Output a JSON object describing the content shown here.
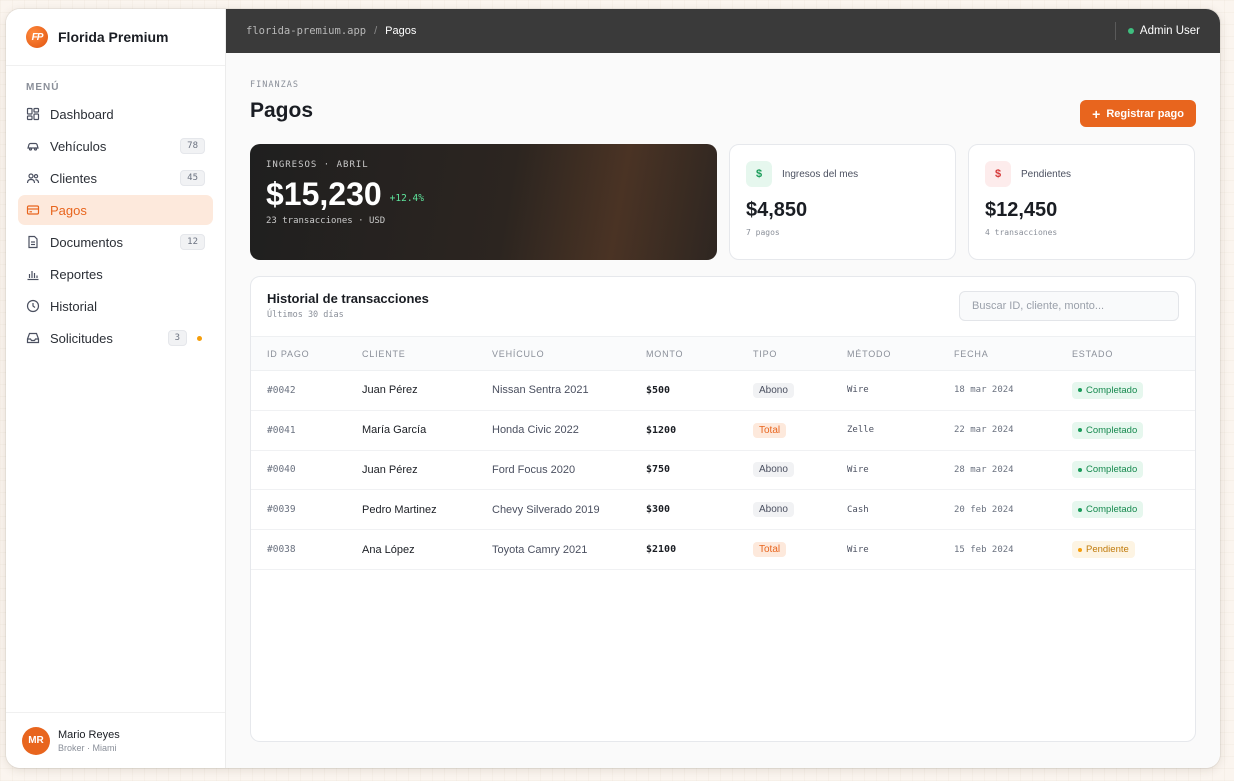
{
  "brand": {
    "name": "Florida Premium",
    "logo_text": "FP"
  },
  "sidebar": {
    "menu_label": "MENÚ",
    "items": [
      {
        "label": "Dashboard",
        "icon": "dashboard-icon",
        "count": ""
      },
      {
        "label": "Vehículos",
        "icon": "car-icon",
        "count": "78"
      },
      {
        "label": "Clientes",
        "icon": "users-icon",
        "count": "45"
      },
      {
        "label": "Pagos",
        "icon": "card-icon",
        "count": "",
        "active": true
      },
      {
        "label": "Documentos",
        "icon": "document-icon",
        "count": "12"
      },
      {
        "label": "Reportes",
        "icon": "bar-chart-icon",
        "count": ""
      },
      {
        "label": "Historial",
        "icon": "clock-icon",
        "count": ""
      },
      {
        "label": "Solicitudes",
        "icon": "inbox-icon",
        "count": "3"
      }
    ],
    "user": {
      "initials": "MR",
      "name": "Mario Reyes",
      "role": "Broker · Miami"
    }
  },
  "topbar": {
    "domain": "florida-premium.app",
    "separator": "/",
    "page": "Pagos",
    "user": "Admin User"
  },
  "page": {
    "eyebrow": "FINANZAS",
    "title": "Pagos",
    "primary_action": "Registrar pago"
  },
  "hero": {
    "label": "INGRESOS · ABRIL",
    "value": "$15,230",
    "delta": "+12.4%",
    "sub": "23 transacciones · USD"
  },
  "stats": [
    {
      "icon": "$",
      "label": "Ingresos del mes",
      "value": "$4,850",
      "sub": "7 pagos"
    },
    {
      "icon": "$",
      "label": "Pendientes",
      "value": "$12,450",
      "sub": "4 transacciones"
    }
  ],
  "table": {
    "title": "Historial de transacciones",
    "subtitle": "Últimos 30 días",
    "search_placeholder": "Buscar ID, cliente, monto...",
    "columns": [
      "ID PAGO",
      "CLIENTE",
      "VEHÍCULO",
      "MONTO",
      "TIPO",
      "MÉTODO",
      "FECHA",
      "ESTADO"
    ],
    "rows": [
      [
        "#0042",
        "Juan Pérez",
        "Nissan Sentra 2021",
        "$500",
        "Abono",
        "Wire",
        "18 mar 2024",
        "Completado"
      ],
      [
        "#0041",
        "María García",
        "Honda Civic 2022",
        "$1200",
        "Total",
        "Zelle",
        "22 mar 2024",
        "Completado"
      ],
      [
        "#0040",
        "Juan Pérez",
        "Ford Focus 2020",
        "$750",
        "Abono",
        "Wire",
        "28 mar 2024",
        "Completado"
      ],
      [
        "#0039",
        "Pedro Martinez",
        "Chevy Silverado 2019",
        "$300",
        "Abono",
        "Cash",
        "20 feb 2024",
        "Completado"
      ],
      [
        "#0038",
        "Ana López",
        "Toyota Camry 2021",
        "$2100",
        "Total",
        "Wire",
        "15 feb 2024",
        "Pendiente"
      ]
    ]
  },
  "colors": {
    "accent": "#e8651e",
    "topbar": "#3a3a3a",
    "success": "#1a9c5a",
    "warning": "#f59e0b"
  }
}
